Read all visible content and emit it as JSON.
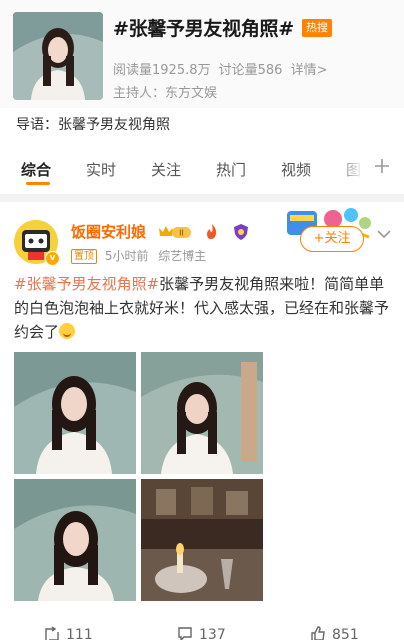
{
  "topic": {
    "title": "#张馨予男友视角照#",
    "hot_badge": "热搜",
    "read_count": "阅读量1925.8万",
    "discussion_count": "讨论量586",
    "details_link": "详情>",
    "host": "主持人：东方文娱",
    "lead": "导语：张馨予男友视角照"
  },
  "tabs": [
    "综合",
    "实时",
    "关注",
    "热门",
    "视频",
    "图"
  ],
  "active_tab": "综合",
  "post": {
    "user_name": "饭圈安利娘",
    "pin_label": "置顶",
    "time": "5小时前",
    "source": "综艺博主",
    "follow_label": "+关注",
    "text_tag": "#张馨予男友视角照#",
    "text_body": "张馨予男友视角照来啦！简简单单的白色泡泡袖上衣就好米！代入感太强，已经在和张馨予约会了",
    "photos": [
      "photo-1",
      "photo-2",
      "photo-3",
      "photo-4"
    ]
  },
  "actions": {
    "repost_count": "111",
    "comment_count": "137",
    "like_count": "851"
  },
  "colors": {
    "accent": "#ff8200",
    "user_name": "#ff6a00",
    "hashtag": "#eb7350"
  }
}
